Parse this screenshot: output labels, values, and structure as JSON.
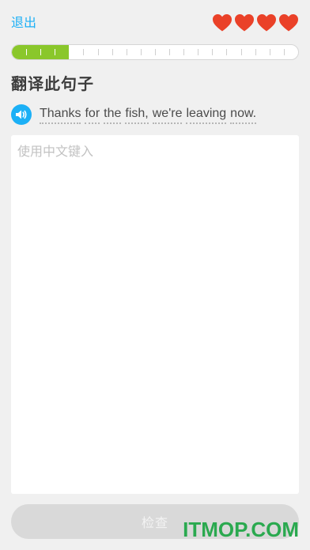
{
  "topbar": {
    "quit_label": "退出",
    "hearts": [
      {
        "icon": "heart-icon",
        "color": "#ea4128"
      },
      {
        "icon": "heart-icon",
        "color": "#ea4128"
      },
      {
        "icon": "heart-icon",
        "color": "#ea4128"
      },
      {
        "icon": "heart-icon",
        "color": "#ea4128"
      }
    ]
  },
  "progress": {
    "completed_segments": 4,
    "total_segments": 20,
    "fill_color": "#8ac72b"
  },
  "prompt": {
    "title": "翻译此句子"
  },
  "sentence": {
    "speaker_icon": "speaker-icon",
    "words": [
      "Thanks",
      "for",
      "the",
      "fish,",
      "we're",
      "leaving",
      "now."
    ]
  },
  "answer": {
    "placeholder": "使用中文键入",
    "value": ""
  },
  "check_button": {
    "label": "检查"
  },
  "watermark": {
    "text": "ITMOP.COM"
  },
  "colors": {
    "accent": "#1cb0f6",
    "heart": "#ea4128",
    "progress": "#8ac72b",
    "background": "#f0f0f0"
  }
}
